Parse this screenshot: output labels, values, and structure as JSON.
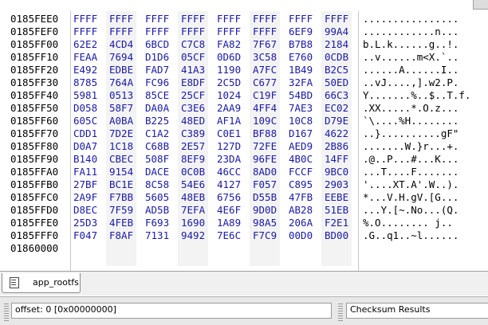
{
  "tab": {
    "label": "app_rootfs",
    "icon": "document-icon"
  },
  "status": {
    "offset": "offset: 0 [0x00000000]",
    "checksum": "Checksum Results"
  },
  "rows": [
    {
      "addr": "0185FEE0",
      "hex": [
        "FFFF",
        "FFFF",
        "FFFF",
        "FFFF",
        "FFFF",
        "FFFF",
        "FFFF",
        "FFFF"
      ],
      "text": "................"
    },
    {
      "addr": "0185FEF0",
      "hex": [
        "FFFF",
        "FFFF",
        "FFFF",
        "FFFF",
        "FFFF",
        "FFFF",
        "6EF9",
        "99A4"
      ],
      "text": "............n..."
    },
    {
      "addr": "0185FF00",
      "hex": [
        "62E2",
        "4CD4",
        "6BCD",
        "C7C8",
        "FA82",
        "7F67",
        "B7B8",
        "2184"
      ],
      "text": "b.L.k......g..!."
    },
    {
      "addr": "0185FF10",
      "hex": [
        "FEAA",
        "7694",
        "D1D6",
        "05CF",
        "0D6D",
        "3C58",
        "E760",
        "0CDB"
      ],
      "text": "..v......m<X.`.."
    },
    {
      "addr": "0185FF20",
      "hex": [
        "E492",
        "EDBE",
        "FAD7",
        "41A3",
        "1190",
        "A7FC",
        "1B49",
        "B2C5"
      ],
      "text": "......A......I.."
    },
    {
      "addr": "0185FF30",
      "hex": [
        "8785",
        "764A",
        "FC96",
        "E8DF",
        "2C5D",
        "C677",
        "32FA",
        "50ED"
      ],
      "text": "..vJ....,].w2.P."
    },
    {
      "addr": "0185FF40",
      "hex": [
        "5981",
        "0513",
        "85CE",
        "25CF",
        "1024",
        "C19F",
        "54BD",
        "66C3"
      ],
      "text": "Y.......%..$..T.f."
    },
    {
      "addr": "0185FF50",
      "hex": [
        "D058",
        "58F7",
        "DA0A",
        "C3E6",
        "2AA9",
        "4FF4",
        "7AE3",
        "EC02"
      ],
      "text": ".XX.....*.O.z..."
    },
    {
      "addr": "0185FF60",
      "hex": [
        "605C",
        "A0BA",
        "B225",
        "48ED",
        "AF1A",
        "109C",
        "10C8",
        "D79E"
      ],
      "text": "`\\....%H........"
    },
    {
      "addr": "0185FF70",
      "hex": [
        "CDD1",
        "7D2E",
        "C1A2",
        "C389",
        "C0E1",
        "BF88",
        "D167",
        "4622"
      ],
      "text": "..}..........gF\""
    },
    {
      "addr": "0185FF80",
      "hex": [
        "D0A7",
        "1C18",
        "C68B",
        "2E57",
        "127D",
        "72FE",
        "AED9",
        "2B86"
      ],
      "text": ".......W.}r...+."
    },
    {
      "addr": "0185FF90",
      "hex": [
        "B140",
        "CBEC",
        "508F",
        "8EF9",
        "23DA",
        "96FE",
        "4B0C",
        "14FF"
      ],
      "text": ".@..P...#...K..."
    },
    {
      "addr": "0185FFA0",
      "hex": [
        "FA11",
        "9154",
        "DACE",
        "0C0B",
        "46CC",
        "8AD0",
        "FCCF",
        "9BC0"
      ],
      "text": "...T....F......."
    },
    {
      "addr": "0185FFB0",
      "hex": [
        "27BF",
        "BC1E",
        "8C58",
        "54E6",
        "4127",
        "F057",
        "C895",
        "2903"
      ],
      "text": "'....XT.A'.W..)."
    },
    {
      "addr": "0185FFC0",
      "hex": [
        "2A9F",
        "F7BB",
        "5605",
        "48EB",
        "6756",
        "D55B",
        "47FB",
        "EEBE"
      ],
      "text": "*...V.H.gV.[G..."
    },
    {
      "addr": "0185FFD0",
      "hex": [
        "D8EC",
        "7F59",
        "AD5B",
        "7EFA",
        "4E6F",
        "9D0D",
        "AB28",
        "51EB"
      ],
      "text": "...Y.[~.No...(Q."
    },
    {
      "addr": "0185FFE0",
      "hex": [
        "25D3",
        "4FEB",
        "F693",
        "1690",
        "1A89",
        "98A5",
        "206A",
        "F2E1"
      ],
      "text": "%.O........ j.."
    },
    {
      "addr": "0185FFF0",
      "hex": [
        "F047",
        "F8AF",
        "7131",
        "9492",
        "7E6C",
        "F7C9",
        "00D0",
        "BD00"
      ],
      "text": ".G..q1..~l......"
    },
    {
      "addr": "01860000",
      "hex": [
        "",
        "",
        "",
        "",
        "",
        "",
        "",
        ""
      ],
      "text": ""
    }
  ]
}
